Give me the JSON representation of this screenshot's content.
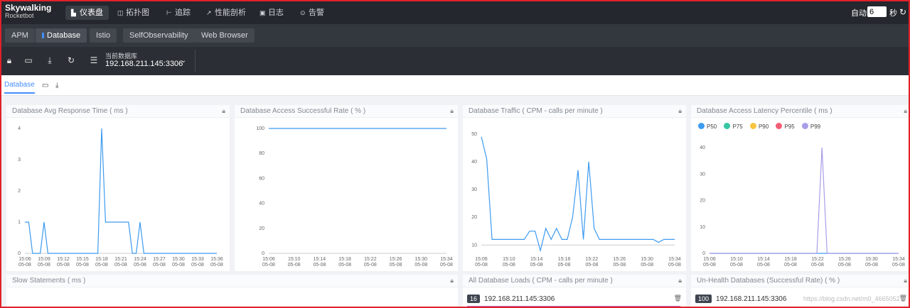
{
  "brand": {
    "name": "Skywalking",
    "sub": "Rocketbot"
  },
  "topnav": {
    "items": [
      {
        "label": "仪表盘",
        "icon": "dashboard-icon",
        "active": true
      },
      {
        "label": "拓扑图",
        "icon": "topology-icon",
        "active": false
      },
      {
        "label": "追踪",
        "icon": "trace-icon",
        "active": false
      },
      {
        "label": "性能剖析",
        "icon": "profile-icon",
        "active": false
      },
      {
        "label": "日志",
        "icon": "log-icon",
        "active": false
      },
      {
        "label": "告警",
        "icon": "alarm-icon",
        "active": false
      }
    ],
    "auto_label": "自动",
    "auto_value": "6",
    "seconds_label": "秒"
  },
  "subnav": {
    "tabs": [
      {
        "label": "APM",
        "active": false
      },
      {
        "label": "Database",
        "active": true
      },
      {
        "label": "Istio",
        "active": false
      },
      {
        "label": "SelfObservability",
        "active": false
      },
      {
        "label": "Web Browser",
        "active": false
      }
    ]
  },
  "toolbar": {
    "db_label": "当前数据库",
    "db_value": "192.168.211.145:3306"
  },
  "dashboard_tab": {
    "label": "Database"
  },
  "colors": {
    "accent": "#448dfe",
    "line": "#3d9bf0",
    "p50": "#3d9bf0",
    "p75": "#36c6a3",
    "p90": "#f7c53d",
    "p95": "#f45f76",
    "p99": "#a89ee8",
    "bar": "#c56ec5"
  },
  "panels": {
    "avg_response": {
      "title": "Database Avg Response Time ( ms )"
    },
    "success_rate": {
      "title": "Database Access Successful Rate ( % )"
    },
    "traffic": {
      "title": "Database Traffic ( CPM - calls per minute )"
    },
    "latency": {
      "title": "Database Access Latency Percentile ( ms )"
    },
    "slow": {
      "title": "Slow Statements ( ms )"
    },
    "loads": {
      "title": "All Database Loads ( CPM - calls per minute )",
      "rows": [
        {
          "value": "16",
          "label": "192.168.211.145:3306"
        }
      ]
    },
    "unhealth": {
      "title": "Un-Health Databases (Successful Rate) ( % )",
      "rows": [
        {
          "value": "100",
          "label": "192.168.211.145:3306"
        }
      ]
    }
  },
  "chart_data": [
    {
      "type": "line",
      "title": "Database Avg Response Time ( ms )",
      "x": [
        "15:06\n05-08",
        "15:09\n05-08",
        "15:12\n05-08",
        "15:15\n05-08",
        "15:18\n05-08",
        "15:21\n05-08",
        "15:24\n05-08",
        "15:27\n05-08",
        "15:30\n05-08",
        "15:33\n05-08",
        "15:36\n05-08"
      ],
      "yticks": [
        "0",
        "1",
        "2",
        "3",
        "4"
      ],
      "ylim": [
        0,
        4
      ],
      "values": [
        1,
        1,
        0,
        0,
        0,
        1,
        0,
        0,
        0,
        0,
        0,
        0,
        0,
        0,
        0,
        0,
        0,
        0,
        0,
        0,
        4,
        1,
        1,
        1,
        1,
        1,
        1,
        1,
        0,
        0,
        1,
        0,
        0,
        0,
        0,
        0,
        0,
        0,
        0,
        0,
        0,
        0,
        0,
        0,
        0,
        0,
        0,
        0,
        0,
        0,
        0
      ],
      "xn": 51
    },
    {
      "type": "line",
      "title": "Database Access Successful Rate ( % )",
      "x": [
        "15:06\n05-08",
        "15:10\n05-08",
        "15:14\n05-08",
        "15:18\n05-08",
        "15:22\n05-08",
        "15:26\n05-08",
        "15:30\n05-08",
        "15:34\n05-08"
      ],
      "yticks": [
        "0",
        "20",
        "40",
        "60",
        "80",
        "100"
      ],
      "ylim": [
        0,
        100
      ],
      "values": [
        100,
        100,
        100,
        100,
        100,
        100,
        100,
        100,
        100,
        100,
        100,
        100,
        100,
        100,
        100,
        100,
        100,
        100,
        100,
        100,
        100,
        100,
        100,
        100,
        100,
        100,
        100,
        100,
        100,
        100,
        100,
        100,
        100,
        100,
        100,
        100,
        100,
        100
      ],
      "xn": 38
    },
    {
      "type": "line",
      "title": "Database Traffic ( CPM - calls per minute )",
      "x": [
        "15:06\n05-08",
        "15:10\n05-08",
        "15:14\n05-08",
        "15:18\n05-08",
        "15:22\n05-08",
        "15:26\n05-08",
        "15:30\n05-08",
        "15:34\n05-08"
      ],
      "yticks": [
        "10",
        "20",
        "30",
        "40",
        "50"
      ],
      "ylim": [
        7,
        52
      ],
      "values": [
        49,
        41,
        12,
        12,
        12,
        12,
        12,
        12,
        12,
        15,
        15,
        8,
        16,
        12,
        16,
        12,
        12,
        20,
        37,
        12,
        40,
        16,
        12,
        12,
        12,
        12,
        12,
        12,
        12,
        12,
        12,
        12,
        12,
        11,
        12,
        12,
        12
      ],
      "xn": 37
    },
    {
      "type": "line",
      "title": "Database Access Latency Percentile ( ms )",
      "x": [
        "15:06\n05-08",
        "15:10\n05-08",
        "15:14\n05-08",
        "15:18\n05-08",
        "15:22\n05-08",
        "15:26\n05-08",
        "15:30\n05-08",
        "15:34\n05-08"
      ],
      "yticks": [
        "0",
        "10",
        "20",
        "30",
        "40"
      ],
      "ylim": [
        0,
        40
      ],
      "legend": [
        "P50",
        "P75",
        "P90",
        "P95",
        "P99"
      ],
      "series": [
        {
          "name": "P50",
          "values": [
            0,
            0,
            0,
            0,
            0,
            0,
            0,
            0,
            0,
            0,
            0,
            0,
            0,
            0,
            0,
            0,
            0,
            0,
            0,
            0,
            0,
            0,
            0,
            0,
            0,
            0,
            0,
            0,
            0,
            0,
            0,
            0,
            0,
            0,
            0,
            0,
            0,
            0
          ]
        },
        {
          "name": "P99",
          "values": [
            0,
            0,
            0,
            0,
            0,
            0,
            0,
            0,
            0,
            0,
            0,
            0,
            0,
            0,
            0,
            0,
            0,
            0,
            0,
            0,
            0,
            0,
            40,
            0,
            0,
            0,
            0,
            0,
            0,
            0,
            0,
            0,
            0,
            0,
            0,
            0,
            0,
            0
          ]
        }
      ],
      "xn": 38
    }
  ],
  "watermark": "https://blog.csdn.net/m0_4665052"
}
